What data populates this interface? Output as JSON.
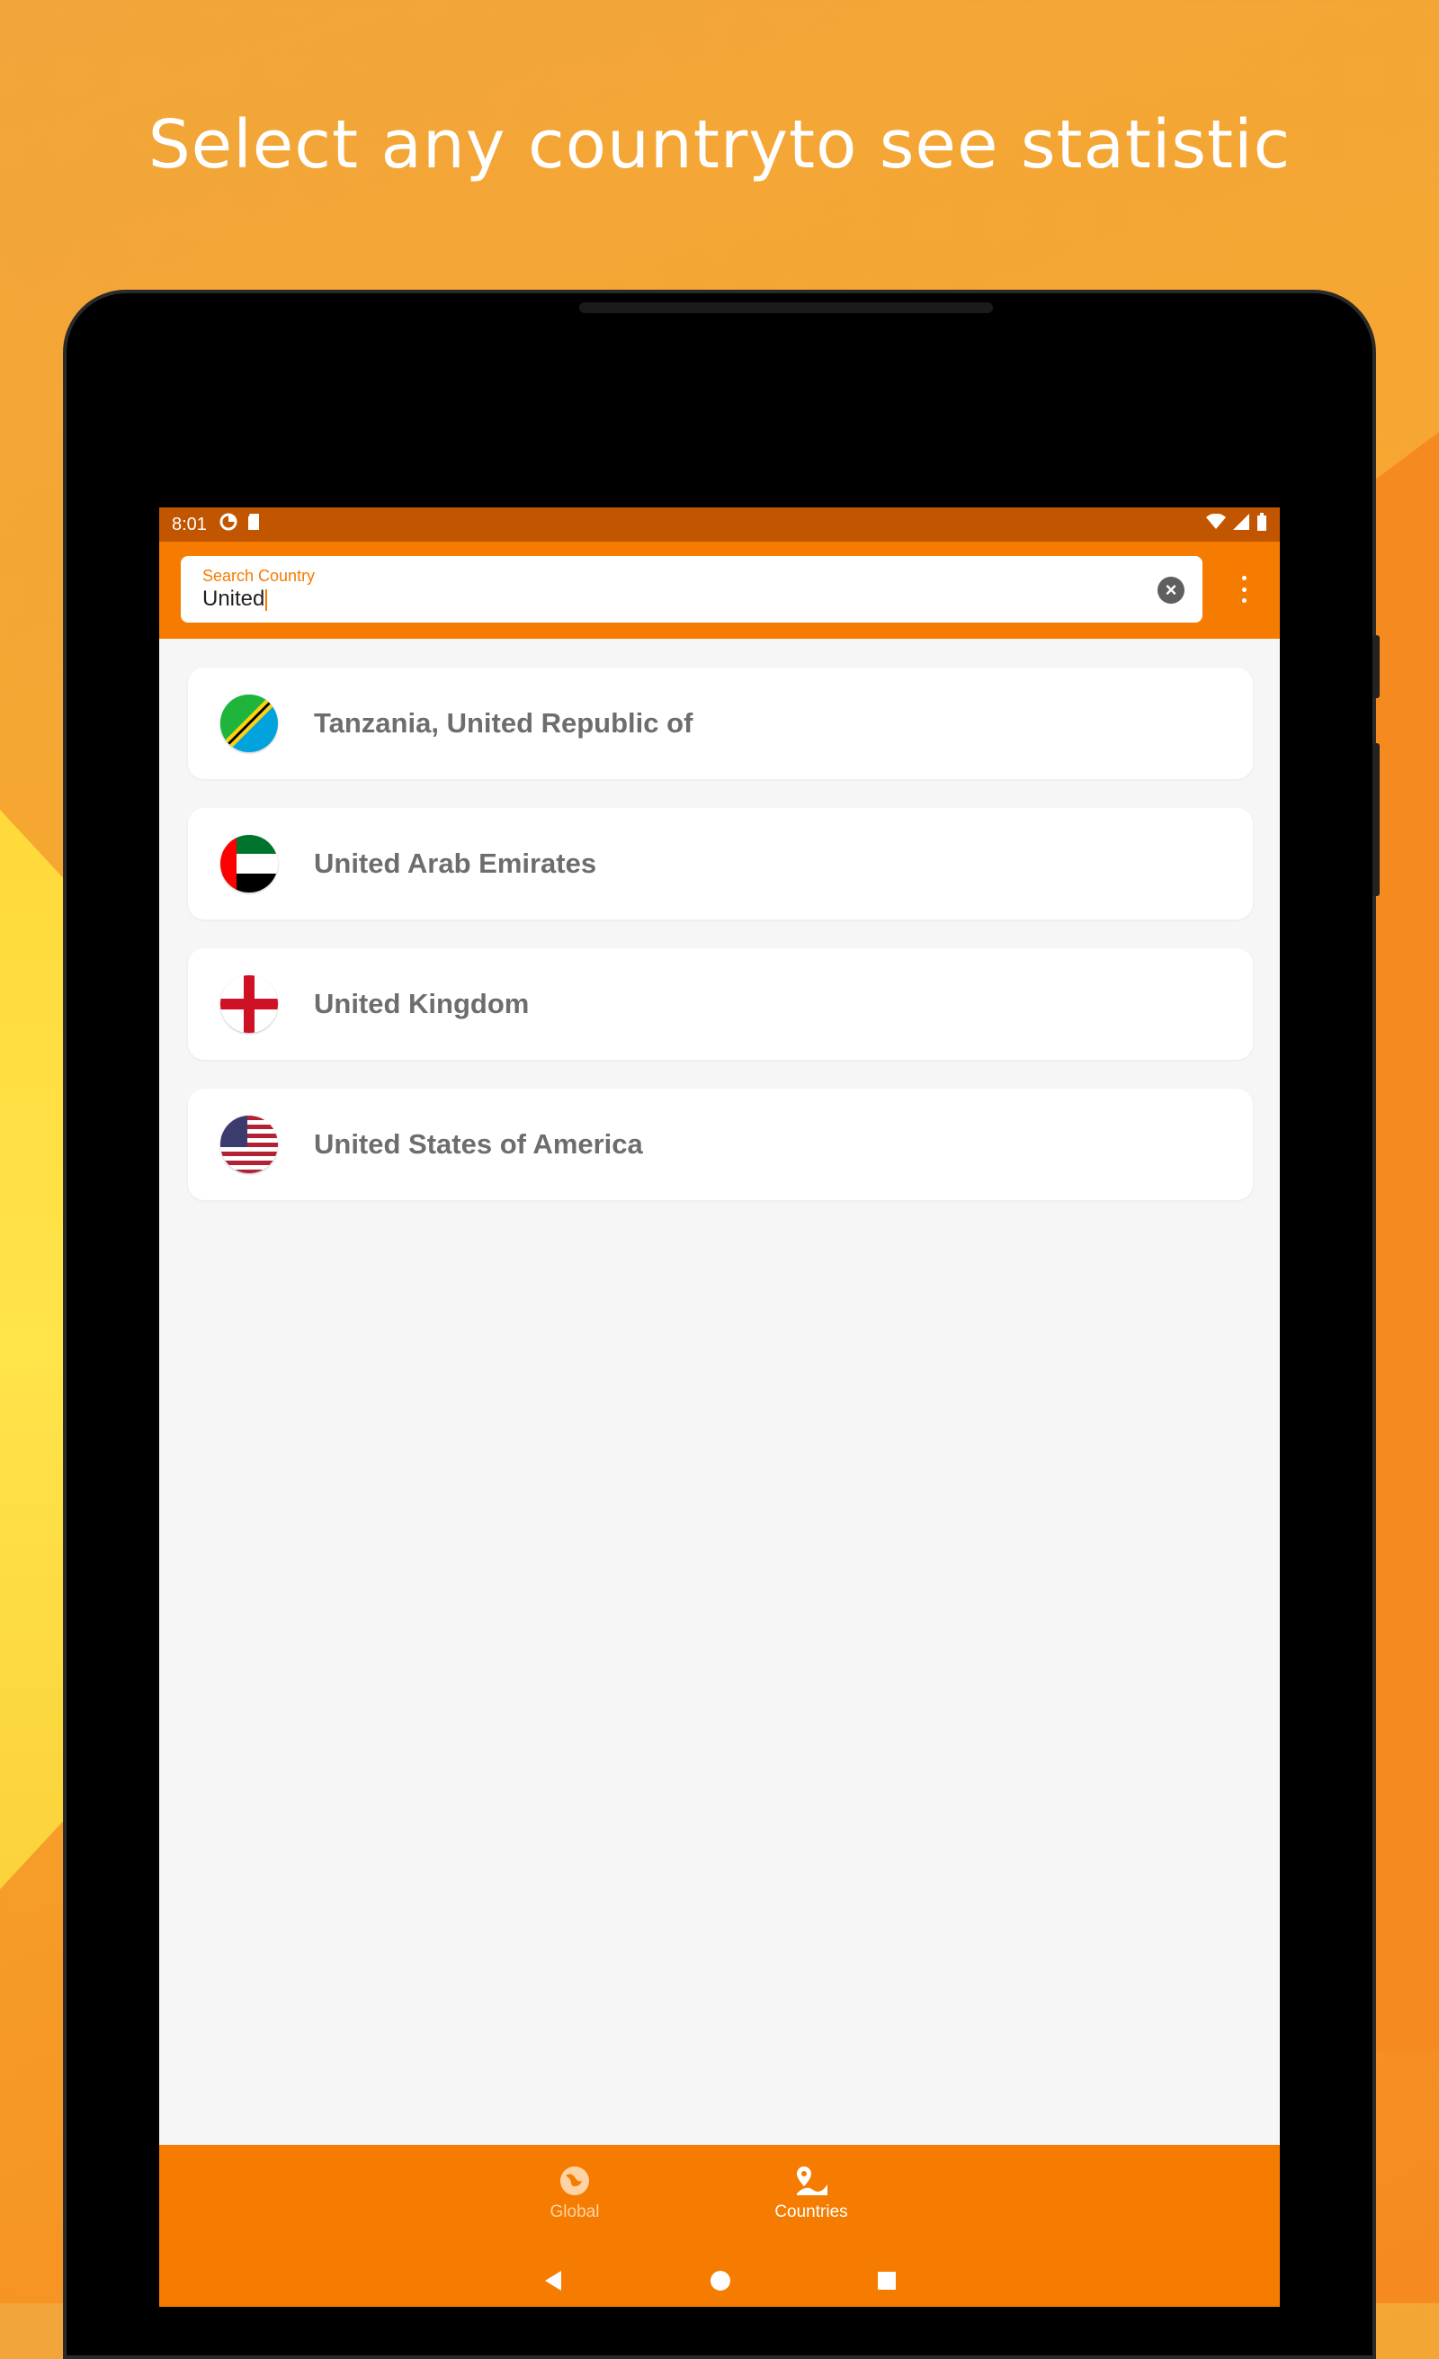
{
  "promo": {
    "headline": "Select any countryto see statistic"
  },
  "status_bar": {
    "time": "8:01"
  },
  "search": {
    "label": "Search Country",
    "value": "United"
  },
  "countries": [
    {
      "name": "Tanzania, United Republic of",
      "flag": "tanzania-flag"
    },
    {
      "name": "United Arab Emirates",
      "flag": "uae-flag"
    },
    {
      "name": "United Kingdom",
      "flag": "england-flag"
    },
    {
      "name": "United States of America",
      "flag": "usa-flag"
    }
  ],
  "bottom_nav": {
    "items": [
      {
        "label": "Global",
        "icon": "globe-icon",
        "active": false
      },
      {
        "label": "Countries",
        "icon": "map-pin-icon",
        "active": true
      }
    ]
  },
  "colors": {
    "accent": "#f57c00",
    "status_bar": "#c25500",
    "background": "#f6f6f6",
    "country_text": "#6d6d6d"
  }
}
